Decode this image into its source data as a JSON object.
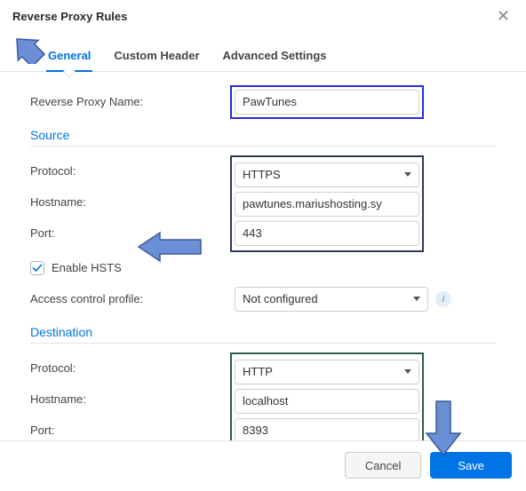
{
  "dialog": {
    "title": "Reverse Proxy Rules"
  },
  "tabs": {
    "general": "General",
    "custom_header": "Custom Header",
    "advanced": "Advanced Settings"
  },
  "fields": {
    "name_label": "Reverse Proxy Name:",
    "name_value": "PawTunes",
    "protocol_label": "Protocol:",
    "hostname_label": "Hostname:",
    "port_label": "Port:",
    "access_label": "Access control profile:",
    "access_value": "Not configured",
    "hsts_label": "Enable HSTS"
  },
  "sections": {
    "source": "Source",
    "destination": "Destination"
  },
  "source": {
    "protocol": "HTTPS",
    "hostname": "pawtunes.mariushosting.sy",
    "port": "443"
  },
  "destination": {
    "protocol": "HTTP",
    "hostname": "localhost",
    "port": "8393"
  },
  "footer": {
    "cancel": "Cancel",
    "save": "Save"
  }
}
